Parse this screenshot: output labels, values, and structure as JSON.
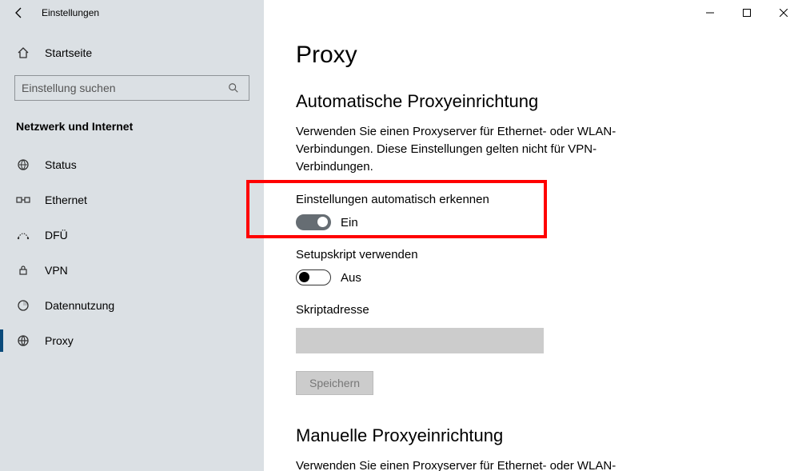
{
  "window": {
    "title": "Einstellungen"
  },
  "sidebar": {
    "home_label": "Startseite",
    "search_placeholder": "Einstellung suchen",
    "section_title": "Netzwerk und Internet",
    "items": [
      {
        "label": "Status"
      },
      {
        "label": "Ethernet"
      },
      {
        "label": "DFÜ"
      },
      {
        "label": "VPN"
      },
      {
        "label": "Datennutzung"
      },
      {
        "label": "Proxy"
      }
    ]
  },
  "main": {
    "page_title": "Proxy",
    "auto_section_title": "Automatische Proxyeinrichtung",
    "auto_section_desc": "Verwenden Sie einen Proxyserver für Ethernet- oder WLAN-Verbindungen. Diese Einstellungen gelten nicht für VPN-Verbindungen.",
    "auto_detect_label": "Einstellungen automatisch erkennen",
    "auto_detect_state": "Ein",
    "script_label": "Setupskript verwenden",
    "script_state": "Aus",
    "script_address_label": "Skriptadresse",
    "script_address_value": "",
    "save_label": "Speichern",
    "manual_section_title": "Manuelle Proxyeinrichtung",
    "manual_section_desc": "Verwenden Sie einen Proxyserver für Ethernet- oder WLAN-"
  }
}
